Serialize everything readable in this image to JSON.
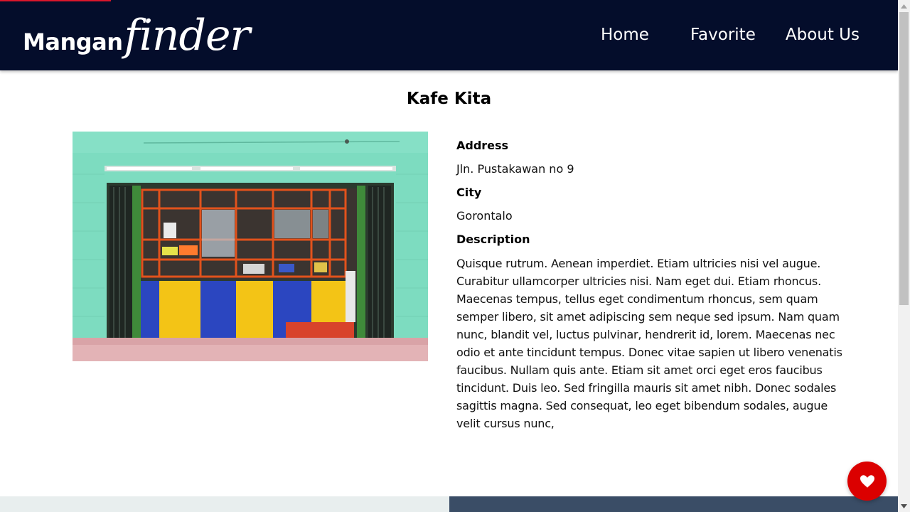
{
  "brand": {
    "part1": "Mangan",
    "part2": "finder"
  },
  "nav": {
    "items": [
      {
        "label": "Home"
      },
      {
        "label": "Favorite"
      },
      {
        "label": "About Us"
      }
    ]
  },
  "restaurant": {
    "name": "Kafe Kita",
    "address_label": "Address",
    "address": "Jln. Pustakawan no 9",
    "city_label": "City",
    "city": "Gorontalo",
    "description_label": "Description",
    "description": "Quisque rutrum. Aenean imperdiet. Etiam ultricies nisi vel augue. Curabitur ullamcorper ultricies nisi. Nam eget dui. Etiam rhoncus. Maecenas tempus, tellus eget condimentum rhoncus, sem quam semper libero, sit amet adipiscing sem neque sed ipsum. Nam quam nunc, blandit vel, luctus pulvinar, hendrerit id, lorem. Maecenas nec odio et ante tincidunt tempus. Donec vitae sapien ut libero venenatis faucibus. Nullam quis ante. Etiam sit amet orci eget eros faucibus tincidunt. Duis leo. Sed fringilla mauris sit amet nibh. Donec sodales sagittis magna. Sed consequat, leo eget bibendum sodales, augue velit cursus nunc,"
  },
  "favorite_button": {
    "icon": "heart-icon",
    "state": "not-favorited"
  },
  "colors": {
    "header_bg": "#040d2b",
    "favorite_button": "#db0000",
    "footer_left": "#e8eeee",
    "footer_right": "#3a4d66",
    "accent_strip": "#d9162b"
  }
}
